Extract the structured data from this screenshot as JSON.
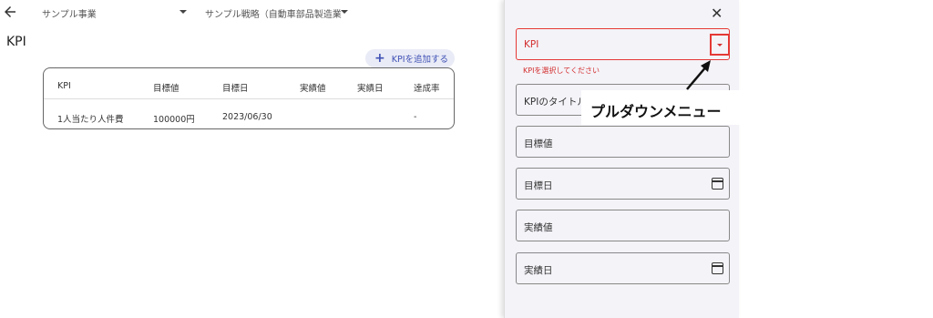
{
  "header": {
    "business_select": "サンプル事業",
    "strategy_select": "サンプル戦略（自動車部品製造業"
  },
  "page": {
    "title": "KPI",
    "add_button": "KPIを追加する"
  },
  "table": {
    "columns": [
      "KPI",
      "目標値",
      "目標日",
      "実績値",
      "実績日",
      "達成率"
    ],
    "rows": [
      [
        "1人当たり人件費",
        "100000円",
        "2023/06/30",
        "",
        "",
        "-"
      ]
    ]
  },
  "panel": {
    "kpi_field": "KPI",
    "kpi_error": "KPIを選択してください",
    "title_field": "KPIのタイトル",
    "target_value_field": "目標値",
    "target_date_field": "目標日",
    "actual_value_field": "実績値",
    "actual_date_field": "実績日"
  },
  "annotation": {
    "text": "プルダウンメニュー"
  },
  "colors": {
    "accent": "#3f51b5",
    "error": "#d32f2f",
    "panel_bg": "#f4f3f8"
  }
}
